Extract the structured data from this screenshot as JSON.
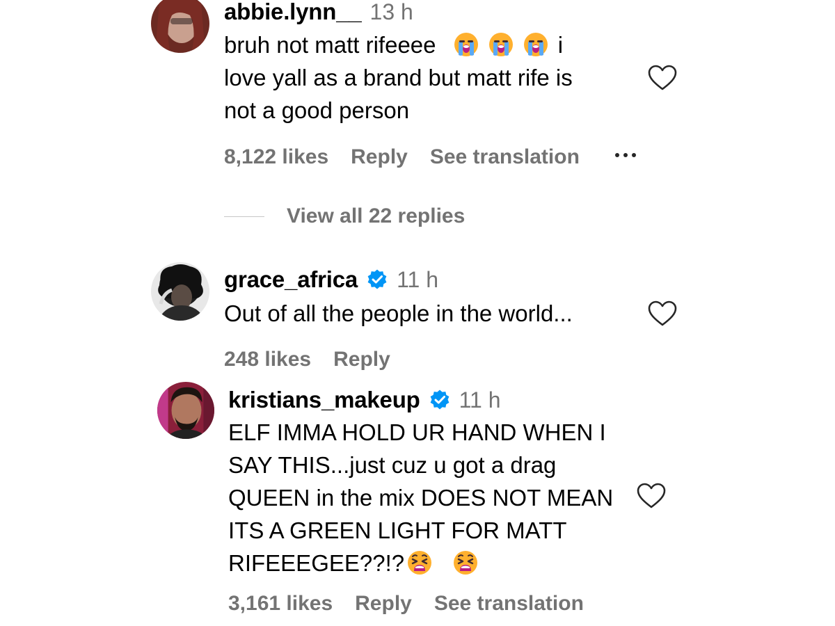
{
  "comments": [
    {
      "username": "abbie.lynn__",
      "time": "13 h",
      "verified": false,
      "text_lines": [
        {
          "text": "bruh not matt rifeeee",
          "emojis": [
            "loudly-crying-face",
            "loudly-crying-face",
            "loudly-crying-face"
          ],
          "after": "i"
        },
        {
          "text": "love yall as a brand but matt rife is"
        },
        {
          "text": "not a good person"
        }
      ],
      "likes": "8,122 likes",
      "reply": "Reply",
      "translate": "See translation",
      "more_icon": "ellipsis-icon",
      "view_replies": "View all 22 replies"
    },
    {
      "username": "grace_africa",
      "time": "11 h",
      "verified": true,
      "text_lines": [
        {
          "text": "Out of all the people in the world..."
        }
      ],
      "likes": "248 likes",
      "reply": "Reply"
    },
    {
      "username": "kristians_makeup",
      "time": "11 h",
      "verified": true,
      "text_lines": [
        {
          "text": "ELF IMMA HOLD UR HAND WHEN I"
        },
        {
          "text": "SAY THIS...just cuz u got a drag"
        },
        {
          "text": "QUEEN in the mix DOES NOT MEAN"
        },
        {
          "text": "ITS A GREEN LIGHT FOR MATT"
        },
        {
          "text": "RIFEEEGEE??!?",
          "emojis": [
            "weary-face",
            "weary-face"
          ]
        }
      ],
      "likes": "3,161 likes",
      "reply": "Reply",
      "translate": "See translation"
    }
  ],
  "icons": {
    "like": "heart-outline-icon",
    "verified": "verified-badge-icon"
  },
  "colors": {
    "text": "#000000",
    "muted": "#737373",
    "verified": "#0095f6"
  }
}
